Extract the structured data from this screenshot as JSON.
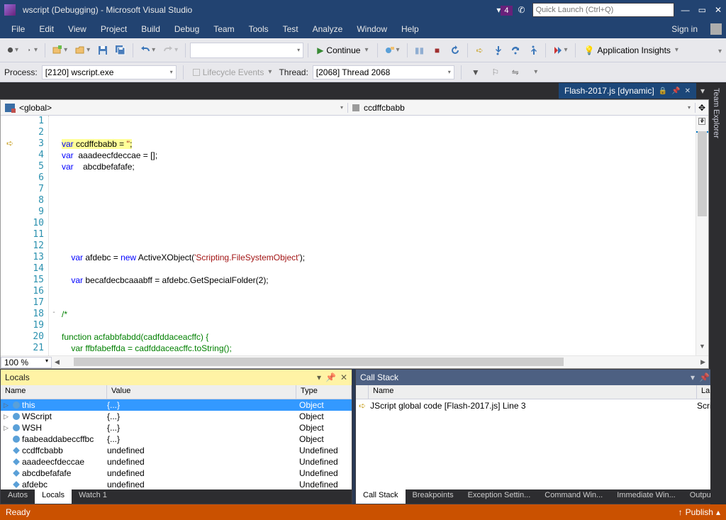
{
  "title": "wscript (Debugging) - Microsoft Visual Studio",
  "notification_count": "4",
  "quick_launch_placeholder": "Quick Launch (Ctrl+Q)",
  "menu": [
    "File",
    "Edit",
    "View",
    "Project",
    "Build",
    "Debug",
    "Team",
    "Tools",
    "Test",
    "Analyze",
    "Window",
    "Help"
  ],
  "sign_in": "Sign in",
  "continue_label": "Continue",
  "insights_label": "Application Insights",
  "process_label": "Process:",
  "process_value": "[2120] wscript.exe",
  "lifecycle_label": "Lifecycle Events",
  "thread_label": "Thread:",
  "thread_value": "[2068] Thread 2068",
  "tab_name": "Flash-2017.js [dynamic]",
  "side_tab": "Team Explorer",
  "scope_left": "<global>",
  "scope_right": "ccdffcbabb",
  "zoom": "100 %",
  "code": {
    "lines": [
      {
        "n": 1,
        "html": ""
      },
      {
        "n": 2,
        "html": ""
      },
      {
        "n": 3,
        "html": "<span class='hl'><span class='kw'>var</span> ccdffcbabb = <span class='str'>''</span>;</span>",
        "current": true
      },
      {
        "n": 4,
        "html": "<span class='kw'>var</span>  aaadeecfdeccae = [];"
      },
      {
        "n": 5,
        "html": "<span class='kw'>var</span>    abcdbefafafe;"
      },
      {
        "n": 6,
        "html": ""
      },
      {
        "n": 7,
        "html": ""
      },
      {
        "n": 8,
        "html": ""
      },
      {
        "n": 9,
        "html": ""
      },
      {
        "n": 10,
        "html": ""
      },
      {
        "n": 11,
        "html": ""
      },
      {
        "n": 12,
        "html": ""
      },
      {
        "n": 13,
        "html": "    <span class='kw'>var</span> afdebc = <span class='kw'>new</span> ActiveXObject(<span class='str'>'Scripting.FileSystemObject'</span>);"
      },
      {
        "n": 14,
        "html": ""
      },
      {
        "n": 15,
        "html": "    <span class='kw'>var</span> becafdecbcaaabff = afdebc.GetSpecialFolder(<span class='num'>2</span>);"
      },
      {
        "n": 16,
        "html": ""
      },
      {
        "n": 17,
        "html": ""
      },
      {
        "n": 18,
        "html": "<span class='comment'>/*</span>",
        "fold": "-"
      },
      {
        "n": 19,
        "html": ""
      },
      {
        "n": 20,
        "html": "<span class='comment'>function acfabbfabdd(cadfddaceacffc) {</span>"
      },
      {
        "n": 21,
        "html": "<span class='comment'>    var ffbfabeffda = cadfddaceacffc.toString();</span>"
      }
    ]
  },
  "locals": {
    "title": "Locals",
    "cols": [
      "Name",
      "Value",
      "Type"
    ],
    "rows": [
      {
        "exp": true,
        "ico": "obj",
        "name": "this",
        "value": "{...}",
        "type": "Object",
        "sel": true
      },
      {
        "exp": true,
        "ico": "obj",
        "name": "WScript",
        "value": "{...}",
        "type": "Object"
      },
      {
        "exp": true,
        "ico": "obj",
        "name": "WSH",
        "value": "{...}",
        "type": "Object"
      },
      {
        "exp": false,
        "ico": "obj",
        "name": "faabeaddabeccffbc",
        "value": "{...}",
        "type": "Object"
      },
      {
        "exp": false,
        "ico": "var",
        "name": "ccdffcbabb",
        "value": "undefined",
        "type": "Undefined"
      },
      {
        "exp": false,
        "ico": "var",
        "name": "aaadeecfdeccae",
        "value": "undefined",
        "type": "Undefined"
      },
      {
        "exp": false,
        "ico": "var",
        "name": "abcdbefafafe",
        "value": "undefined",
        "type": "Undefined"
      },
      {
        "exp": false,
        "ico": "var",
        "name": "afdebc",
        "value": "undefined",
        "type": "Undefined"
      }
    ],
    "tabs": [
      "Autos",
      "Locals",
      "Watch 1"
    ],
    "active_tab": 1
  },
  "callstack": {
    "title": "Call Stack",
    "cols": [
      "Name",
      "Lang"
    ],
    "row_name": "JScript global code [Flash-2017.js] Line 3",
    "row_lang": "Scrip",
    "tabs": [
      "Call Stack",
      "Breakpoints",
      "Exception Settin...",
      "Command Win...",
      "Immediate Win...",
      "Output"
    ],
    "active_tab": 0
  },
  "status_left": "Ready",
  "status_right": "Publish"
}
